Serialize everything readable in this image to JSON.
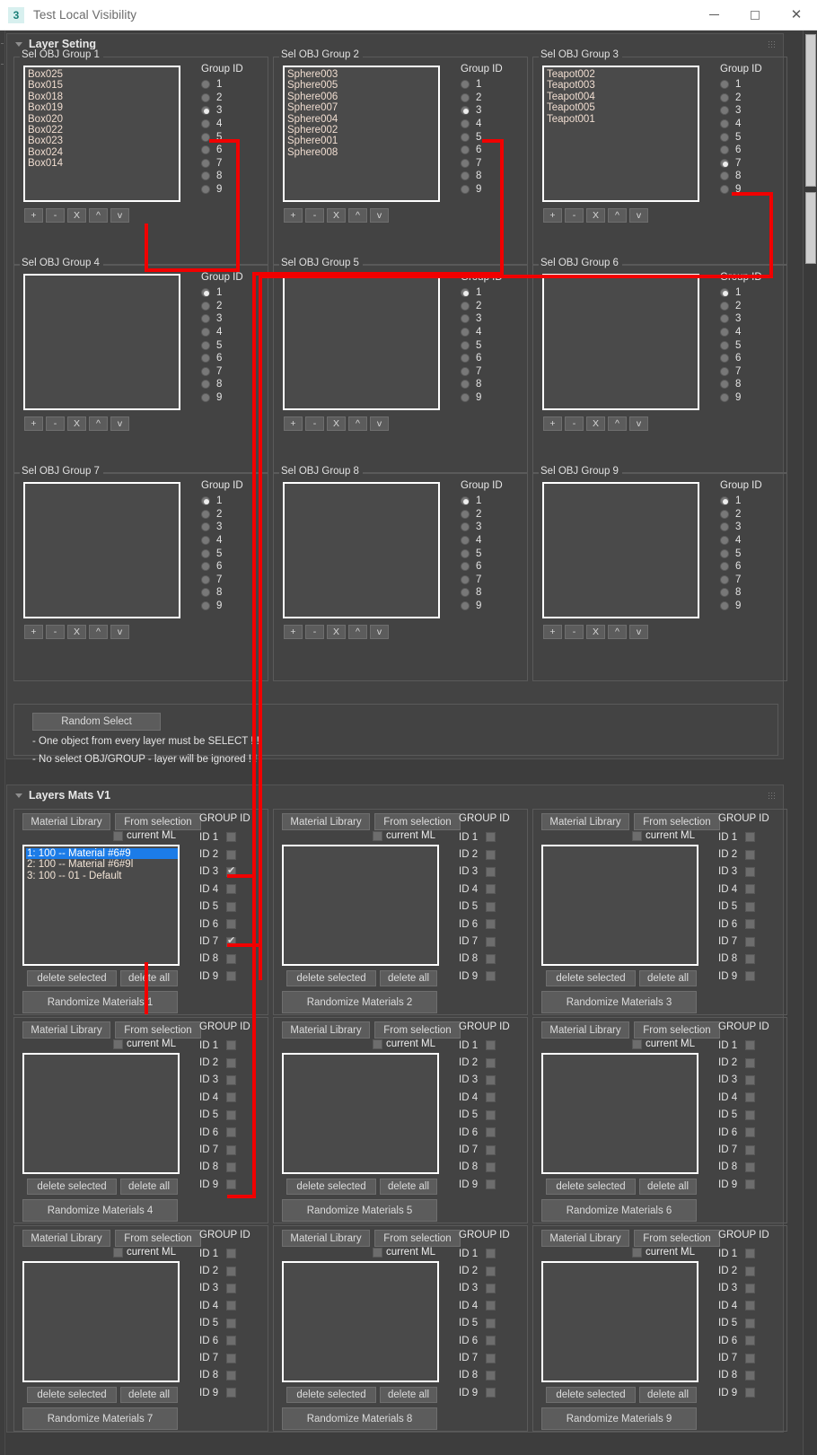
{
  "window": {
    "title": "Test Local Visibility",
    "icon_label": "3",
    "icon_name": "app-3dsmax-icon",
    "minimize_label": "—",
    "maximize_label": "□",
    "close_label": "✕"
  },
  "accent": {
    "annotation_red": "#f10000",
    "selection_blue": "#1c7ce8",
    "panel_bg": "#434343",
    "list_bg": "#4a4a4a"
  },
  "rollouts": [
    {
      "title": "Layer Seting"
    },
    {
      "title": "Layers Mats V1"
    }
  ],
  "obj_button_labels": [
    "+",
    "-",
    "X",
    "^",
    "v"
  ],
  "group_id_header": "Group ID",
  "group_id_options": [
    "1",
    "2",
    "3",
    "4",
    "5",
    "6",
    "7",
    "8",
    "9"
  ],
  "obj_groups": [
    {
      "title": "Sel OBJ Group 1",
      "items": [
        "Box025",
        "Box015",
        "Box018",
        "Box019",
        "Box020",
        "Box022",
        "Box023",
        "Box024",
        "Box014"
      ],
      "selected_group_id": 3
    },
    {
      "title": "Sel OBJ Group 2",
      "items": [
        "Sphere003",
        "Sphere005",
        "Sphere006",
        "Sphere007",
        "Sphere004",
        "Sphere002",
        "Sphere001",
        "Sphere008"
      ],
      "selected_group_id": 3
    },
    {
      "title": "Sel OBJ Group 3",
      "items": [
        "Teapot002",
        "Teapot003",
        "Teapot004",
        "Teapot005",
        "Teapot001"
      ],
      "selected_group_id": 7
    },
    {
      "title": "Sel OBJ Group 4",
      "items": [],
      "selected_group_id": 1
    },
    {
      "title": "Sel OBJ Group 5",
      "items": [],
      "selected_group_id": 1
    },
    {
      "title": "Sel OBJ Group 6",
      "items": [],
      "selected_group_id": 1
    },
    {
      "title": "Sel OBJ Group 7",
      "items": [],
      "selected_group_id": 1
    },
    {
      "title": "Sel OBJ Group 8",
      "items": [],
      "selected_group_id": 1
    },
    {
      "title": "Sel OBJ Group 9",
      "items": [],
      "selected_group_id": 1
    }
  ],
  "random_select": {
    "button_label": "Random Select",
    "hint1": "- One object from every layer must be SELECT ! !",
    "hint2": "- No select OBJ/GROUP  - layer will be ignored ! !"
  },
  "mats": {
    "material_library_label": "Material Library",
    "from_selection_label": "From selection",
    "current_ml_label": "current ML",
    "group_id_header": "GROUP ID",
    "id_labels": [
      "ID 1",
      "ID 2",
      "ID 3",
      "ID 4",
      "ID 5",
      "ID 6",
      "ID 7",
      "ID 8",
      "ID 9"
    ],
    "delete_selected_label": "delete selected",
    "delete_all_label": "delete all"
  },
  "mat_panels": [
    {
      "randomize_label": "Randomize Materials 1",
      "current_ml_checked": false,
      "items": [
        {
          "text": "1:  100 -- Material #6#9",
          "selected": true
        },
        {
          "text": "2:  100 -- Material #6#9l",
          "selected": false
        },
        {
          "text": "3:  100 -- 01 - Default",
          "selected": false
        }
      ],
      "checked_ids": [
        3,
        7
      ]
    },
    {
      "randomize_label": "Randomize Materials 2",
      "current_ml_checked": false,
      "items": [],
      "checked_ids": []
    },
    {
      "randomize_label": "Randomize Materials 3",
      "current_ml_checked": false,
      "items": [],
      "checked_ids": []
    },
    {
      "randomize_label": "Randomize Materials 4",
      "current_ml_checked": false,
      "items": [],
      "checked_ids": []
    },
    {
      "randomize_label": "Randomize Materials 5",
      "current_ml_checked": false,
      "items": [],
      "checked_ids": []
    },
    {
      "randomize_label": "Randomize Materials 6",
      "current_ml_checked": false,
      "items": [],
      "checked_ids": []
    },
    {
      "randomize_label": "Randomize Materials 7",
      "current_ml_checked": false,
      "items": [],
      "checked_ids": []
    },
    {
      "randomize_label": "Randomize Materials 8",
      "current_ml_checked": false,
      "items": [],
      "checked_ids": []
    },
    {
      "randomize_label": "Randomize Materials 9",
      "current_ml_checked": false,
      "items": [],
      "checked_ids": []
    }
  ]
}
